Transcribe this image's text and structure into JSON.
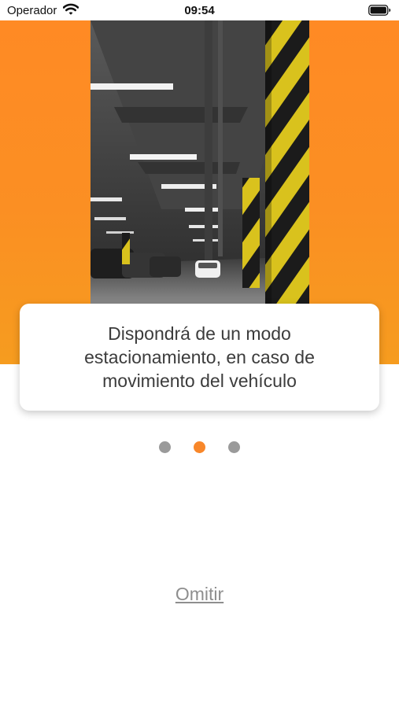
{
  "status_bar": {
    "carrier": "Operador",
    "time": "09:54",
    "wifi_icon": "wifi-icon",
    "battery_icon": "battery-icon"
  },
  "hero": {
    "background_colors": [
      "#ff8a24",
      "#f69c1f"
    ],
    "image_subject": "parking-garage-photo"
  },
  "card": {
    "text": "Dispondrá de un modo estacionamiento, en caso de movimiento del vehículo"
  },
  "pager": {
    "total": 3,
    "active_index": 1,
    "active_color": "#f8872a",
    "inactive_color": "#9a9a9a"
  },
  "skip_label": "Omitir"
}
